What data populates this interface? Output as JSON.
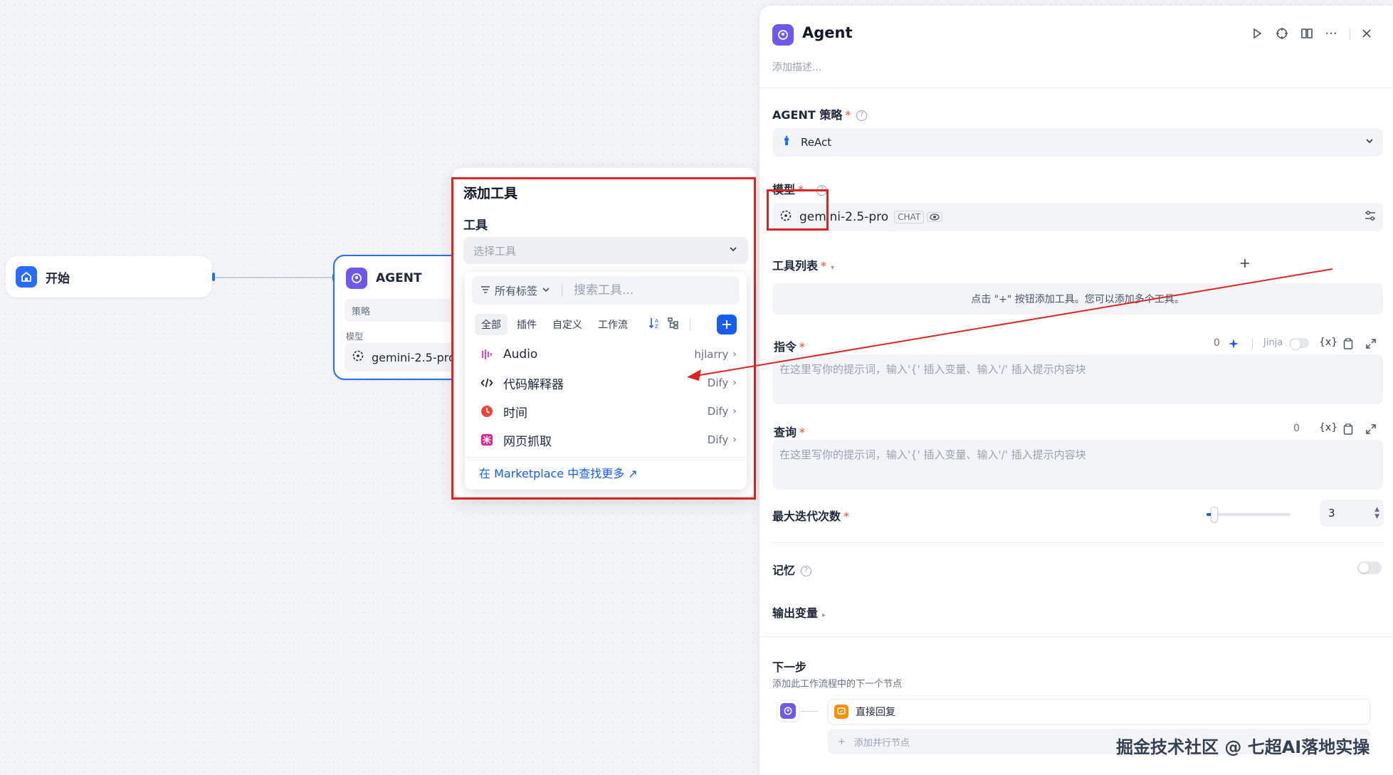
{
  "canvas": {
    "start_node": {
      "title": "开始"
    },
    "agent_node": {
      "title": "AGENT",
      "strategy_label": "策略",
      "model_label": "模型",
      "model_value": "gemini-2.5-pro"
    }
  },
  "add_tool_popover": {
    "title": "添加工具",
    "tool_label": "工具",
    "select_placeholder": "选择工具",
    "tag_filter": "所有标签",
    "search_placeholder": "搜索工具...",
    "tabs": [
      "全部",
      "插件",
      "自定义",
      "工作流"
    ],
    "tools": [
      {
        "name": "Audio",
        "source": "hjlarry"
      },
      {
        "name": "代码解释器",
        "source": "Dify"
      },
      {
        "name": "时间",
        "source": "Dify"
      },
      {
        "name": "网页抓取",
        "source": "Dify"
      }
    ],
    "marketplace_link": "在 Marketplace 中查找更多 ↗"
  },
  "panel": {
    "title": "Agent",
    "description_placeholder": "添加描述...",
    "strategy": {
      "label": "AGENT 策略",
      "value": "ReAct"
    },
    "model": {
      "label": "模型",
      "value": "gemini-2.5-pro",
      "badge": "CHAT"
    },
    "tool_list": {
      "label": "工具列表",
      "hint": "点击 \"+\" 按钮添加工具。您可以添加多个工具。"
    },
    "instruction": {
      "label": "指令",
      "count": "0",
      "jinja_label": "Jinja",
      "var_label": "{x}",
      "placeholder": "在这里写你的提示词，输入'{' 插入变量、输入'/' 插入提示内容块"
    },
    "query": {
      "label": "查询",
      "count": "0",
      "var_label": "{x}",
      "placeholder": "在这里写你的提示词，输入'{' 插入变量、输入'/' 插入提示内容块"
    },
    "max_iterations": {
      "label": "最大迭代次数",
      "value": "3",
      "slider_fraction": 0.05
    },
    "memory": {
      "label": "记忆"
    },
    "output_vars": {
      "label": "输出变量"
    },
    "next_step": {
      "label": "下一步",
      "description": "添加此工作流程中的下一个节点",
      "node": "直接回复",
      "add_parallel": "添加并行节点"
    }
  },
  "watermark": "掘金技术社区 @ 七超AI落地实操",
  "colors": {
    "accent": "#296dff",
    "danger": "#e02424",
    "agent_icon": "#6f58ea",
    "reply_icon": "#f79009"
  }
}
